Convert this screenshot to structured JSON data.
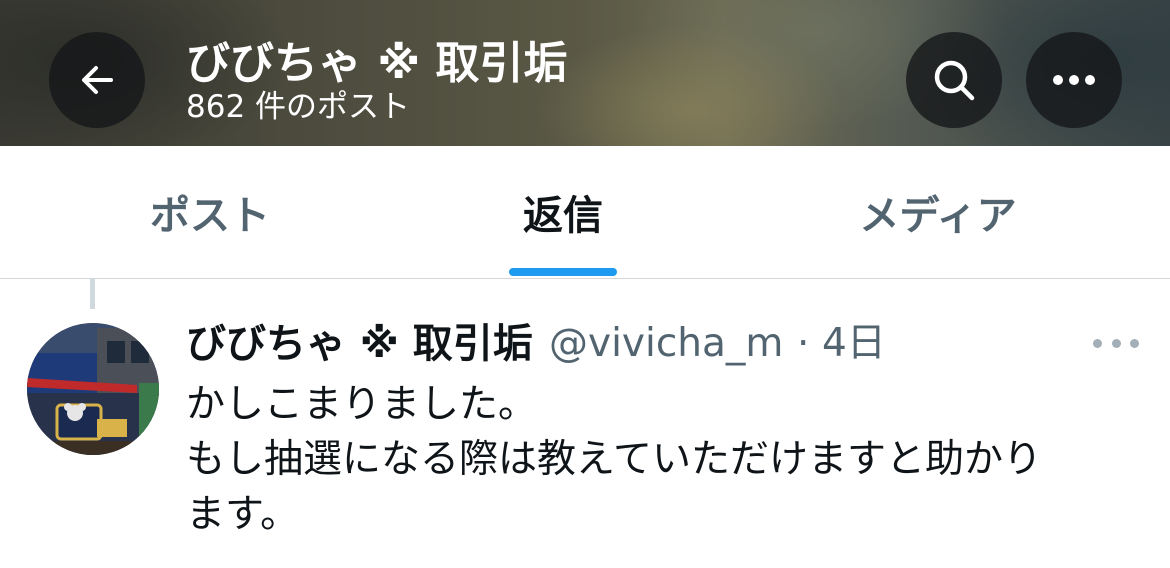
{
  "header": {
    "title": "びびちゃ ※ 取引垢",
    "post_count": "862 件のポスト",
    "back_icon": "arrow-left-icon",
    "search_icon": "search-icon",
    "more_icon": "more-horizontal-icon"
  },
  "tabs": [
    {
      "label": "ポスト",
      "active": false
    },
    {
      "label": "返信",
      "active": true
    },
    {
      "label": "メディア",
      "active": false
    }
  ],
  "post": {
    "display_name": "びびちゃ ※ 取引垢",
    "handle": "@vivicha_m",
    "separator": "·",
    "time": "4日",
    "lines": [
      "かしこまりました。",
      "もし抽選になる際は教えていただけますと助かり",
      "ます。"
    ],
    "more_icon": "more-horizontal-icon"
  },
  "colors": {
    "accent": "#1d9bf0",
    "text_primary": "#0f1419",
    "text_secondary": "#536471"
  }
}
